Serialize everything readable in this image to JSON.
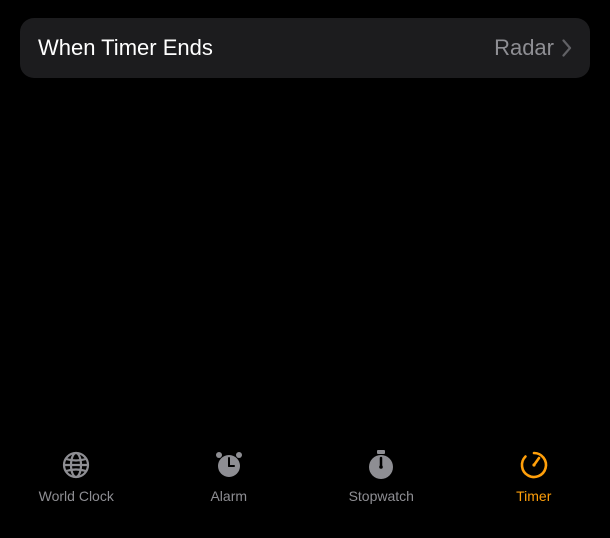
{
  "row": {
    "label": "When Timer Ends",
    "value": "Radar"
  },
  "tabs": {
    "world_clock": "World Clock",
    "alarm": "Alarm",
    "stopwatch": "Stopwatch",
    "timer": "Timer"
  },
  "colors": {
    "accent": "#ff9f0a",
    "inactive": "#8e8e93",
    "card": "#1c1c1e"
  }
}
